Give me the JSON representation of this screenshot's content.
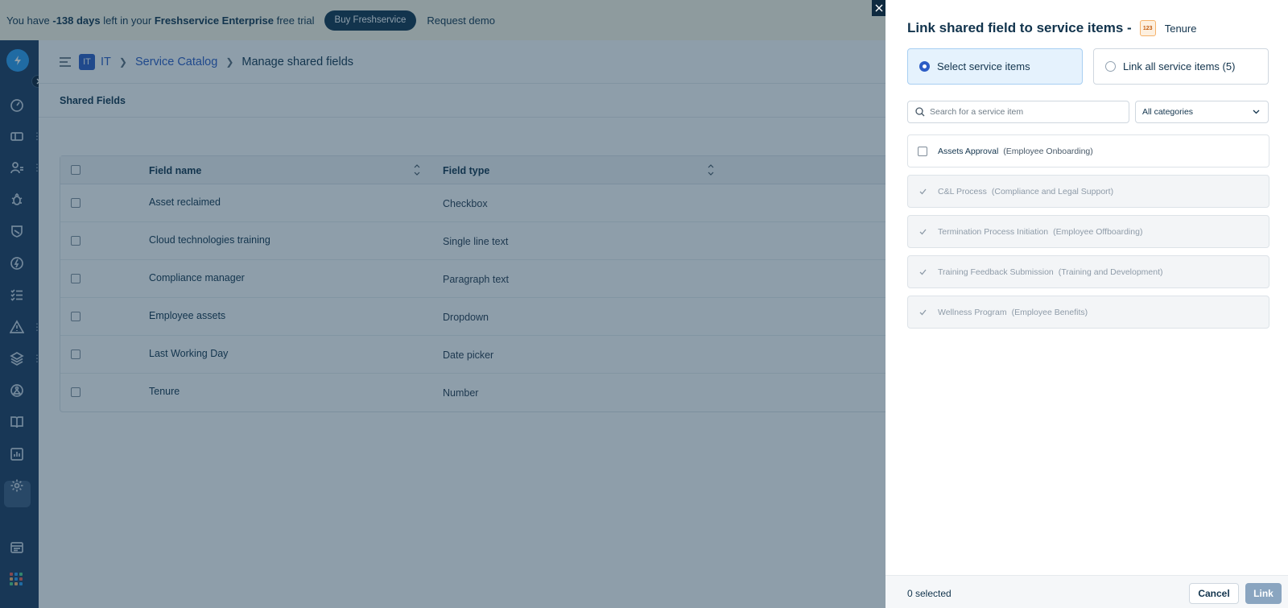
{
  "banner": {
    "prefix": "You have ",
    "days": "-138 days",
    "middle": " left in your ",
    "product": "Freshservice Enterprise",
    "suffix": " free trial",
    "buy_label": "Buy Freshservice",
    "demo_label": "Request demo"
  },
  "nav": {
    "icons": [
      "dashboard-icon",
      "tickets-icon",
      "users-icon",
      "problems-icon",
      "changes-icon",
      "releases-icon",
      "tasks-icon",
      "alerts-icon",
      "assets-icon",
      "contracts-icon",
      "solutions-icon",
      "reports-icon",
      "admin-icon",
      "inbox-icon",
      "apps-icon"
    ],
    "active": "admin-icon"
  },
  "breadcrumb": {
    "workspace_badge": "IT",
    "workspace": "IT",
    "section": "Service Catalog",
    "current": "Manage shared fields"
  },
  "subbar": {
    "title": "Shared Fields"
  },
  "table": {
    "columns": [
      "Field name",
      "Field type"
    ],
    "rows": [
      {
        "name": "Asset reclaimed",
        "type": "Checkbox"
      },
      {
        "name": "Cloud technologies training",
        "type": "Single line text"
      },
      {
        "name": "Compliance manager",
        "type": "Paragraph text"
      },
      {
        "name": "Employee assets",
        "type": "Dropdown"
      },
      {
        "name": "Last Working Day",
        "type": "Date picker"
      },
      {
        "name": "Tenure",
        "type": "Number"
      }
    ]
  },
  "panel": {
    "title": "Link shared field to service items -",
    "field_badge": "123",
    "field_name": "Tenure",
    "option_select": "Select service items",
    "option_all": "Link all service items (5)",
    "search_placeholder": "Search for a service item",
    "category_filter": "All categories",
    "items": [
      {
        "name": "Assets Approval",
        "category": "(Employee Onboarding)",
        "disabled": false
      },
      {
        "name": "C&L Process",
        "category": "(Compliance and Legal Support)",
        "disabled": true
      },
      {
        "name": "Termination Process Initiation",
        "category": "(Employee Offboarding)",
        "disabled": true
      },
      {
        "name": "Training Feedback Submission",
        "category": "(Training and Development)",
        "disabled": true
      },
      {
        "name": "Wellness Program",
        "category": "(Employee Benefits)",
        "disabled": true
      }
    ],
    "selected_count": "0 selected",
    "cancel_label": "Cancel",
    "link_label": "Link"
  },
  "colors": {
    "nav_bg": "#1e3a5f",
    "accent": "#2c5cc5",
    "overlay": "#12344d",
    "link_button_disabled": "#8aa5c0"
  }
}
